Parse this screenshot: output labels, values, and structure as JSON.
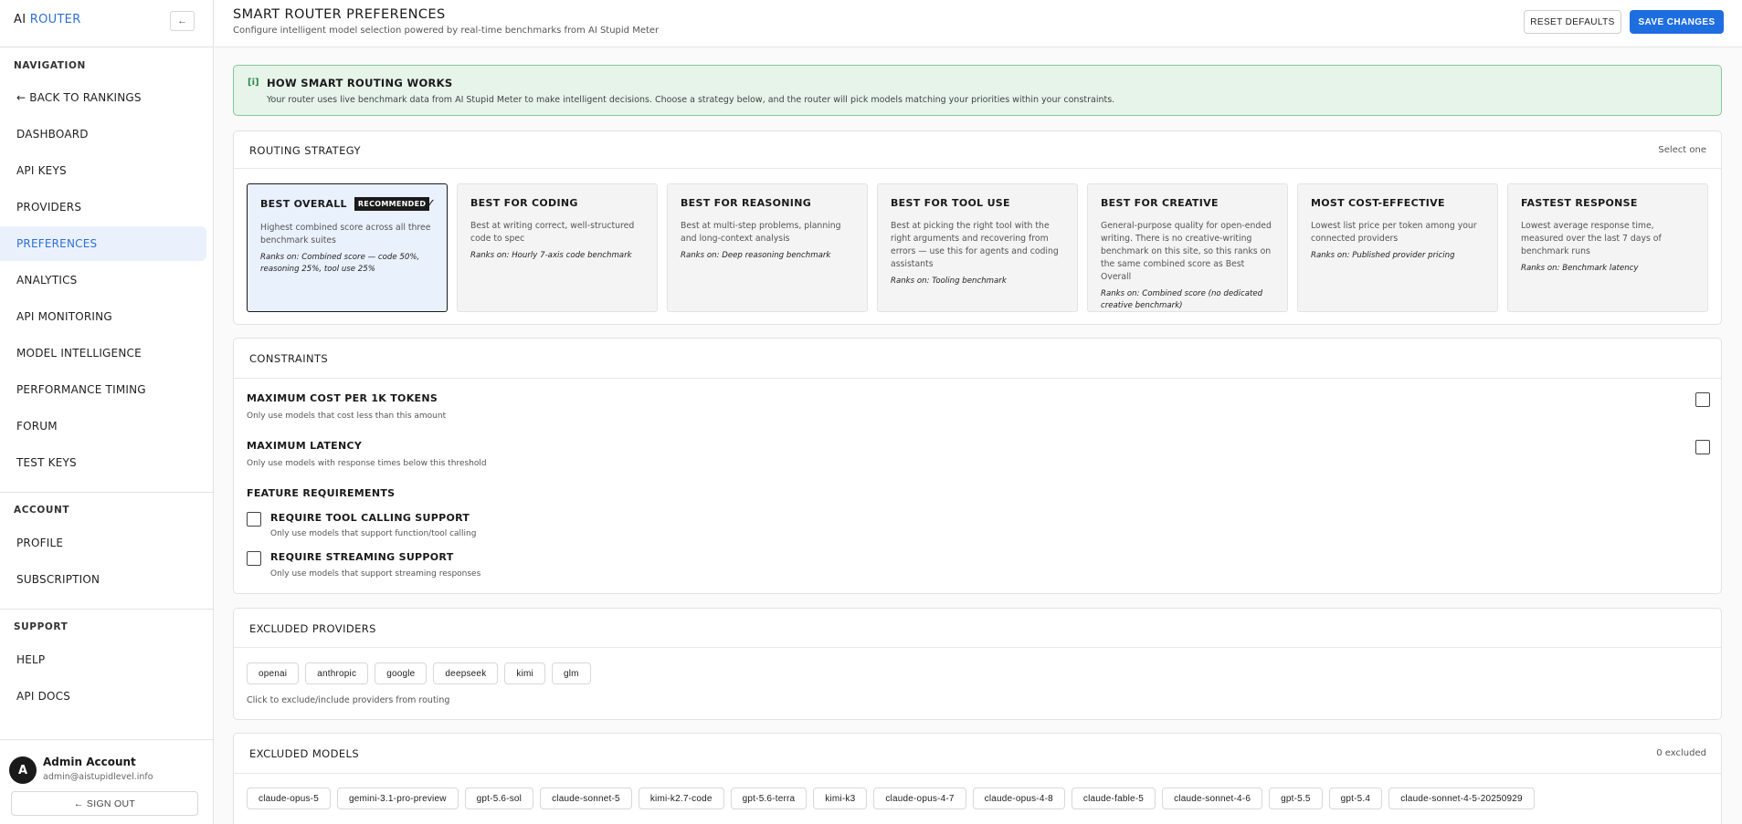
{
  "brand": {
    "prefix": "AI",
    "accent": "ROUTER"
  },
  "sidebar": {
    "collapse_label": "←",
    "sections": [
      {
        "title": "NAVIGATION"
      },
      {
        "title": "ACCOUNT"
      },
      {
        "title": "SUPPORT"
      }
    ],
    "nav": [
      {
        "label": "← BACK TO RANKINGS"
      },
      {
        "label": "DASHBOARD"
      },
      {
        "label": "API KEYS"
      },
      {
        "label": "PROVIDERS"
      },
      {
        "label": "PREFERENCES",
        "active": true
      },
      {
        "label": "ANALYTICS"
      },
      {
        "label": "API MONITORING"
      },
      {
        "label": "MODEL INTELLIGENCE"
      },
      {
        "label": "PERFORMANCE TIMING"
      },
      {
        "label": "FORUM"
      },
      {
        "label": "TEST KEYS"
      }
    ],
    "account": [
      {
        "label": "PROFILE"
      },
      {
        "label": "SUBSCRIPTION"
      }
    ],
    "support": [
      {
        "label": "HELP"
      },
      {
        "label": "API DOCS"
      }
    ],
    "user": {
      "initial": "A",
      "name": "Admin Account",
      "email": "admin@aistupidlevel.info",
      "signout_label": "← SIGN OUT"
    }
  },
  "header": {
    "title": "SMART ROUTER PREFERENCES",
    "subtitle": "Configure intelligent model selection powered by real-time benchmarks from AI Stupid Meter",
    "reset_label": "RESET DEFAULTS",
    "save_label": "SAVE CHANGES"
  },
  "info": {
    "icon": "[i]",
    "title": "HOW SMART ROUTING WORKS",
    "text": "Your router uses live benchmark data from AI Stupid Meter to make intelligent decisions. Choose a strategy below, and the router will pick models matching your priorities within your constraints."
  },
  "strategy": {
    "title": "ROUTING STRATEGY",
    "meta": "Select one",
    "options": [
      {
        "name": "BEST OVERALL",
        "badge": "RECOMMENDED",
        "check": "✓",
        "desc": "Highest combined score across all three benchmark suites",
        "rank": "Ranks on: Combined score — code 50%, reasoning 25%, tool use 25%"
      },
      {
        "name": "BEST FOR CODING",
        "desc": "Best at writing correct, well-structured code to spec",
        "rank": "Ranks on: Hourly 7-axis code benchmark"
      },
      {
        "name": "BEST FOR REASONING",
        "desc": "Best at multi-step problems, planning and long-context analysis",
        "rank": "Ranks on: Deep reasoning benchmark"
      },
      {
        "name": "BEST FOR TOOL USE",
        "desc": "Best at picking the right tool with the right arguments and recovering from errors — use this for agents and coding assistants",
        "rank": "Ranks on: Tooling benchmark"
      },
      {
        "name": "BEST FOR CREATIVE",
        "desc": "General-purpose quality for open-ended writing. There is no creative-writing benchmark on this site, so this ranks on the same combined score as Best Overall",
        "rank": "Ranks on: Combined score (no dedicated creative benchmark)"
      },
      {
        "name": "MOST COST-EFFECTIVE",
        "desc": "Lowest list price per token among your connected providers",
        "rank": "Ranks on: Published provider pricing"
      },
      {
        "name": "FASTEST RESPONSE",
        "desc": "Lowest average response time, measured over the last 7 days of benchmark runs",
        "rank": "Ranks on: Benchmark latency"
      }
    ]
  },
  "constraints": {
    "title": "CONSTRAINTS",
    "max_cost": {
      "label": "MAXIMUM COST PER 1K TOKENS",
      "help": "Only use models that cost less than this amount"
    },
    "max_latency": {
      "label": "MAXIMUM LATENCY",
      "help": "Only use models with response times below this threshold"
    },
    "features_title": "FEATURE REQUIREMENTS",
    "tool_calling": {
      "label": "REQUIRE TOOL CALLING SUPPORT",
      "help": "Only use models that support function/tool calling"
    },
    "streaming": {
      "label": "REQUIRE STREAMING SUPPORT",
      "help": "Only use models that support streaming responses"
    }
  },
  "excluded_providers": {
    "title": "EXCLUDED PROVIDERS",
    "providers": [
      "openai",
      "anthropic",
      "google",
      "deepseek",
      "kimi",
      "glm"
    ],
    "help": "Click to exclude/include providers from routing"
  },
  "excluded_models": {
    "title": "EXCLUDED MODELS",
    "meta": "0 excluded",
    "models": [
      "claude-opus-5",
      "gemini-3.1-pro-preview",
      "gpt-5.6-sol",
      "claude-sonnet-5",
      "kimi-k2.7-code",
      "gpt-5.6-terra",
      "kimi-k3",
      "claude-opus-4-7",
      "claude-opus-4-8",
      "claude-fable-5",
      "claude-sonnet-4-6",
      "gpt-5.5",
      "gpt-5.4",
      "claude-sonnet-4-5-20250929"
    ]
  }
}
